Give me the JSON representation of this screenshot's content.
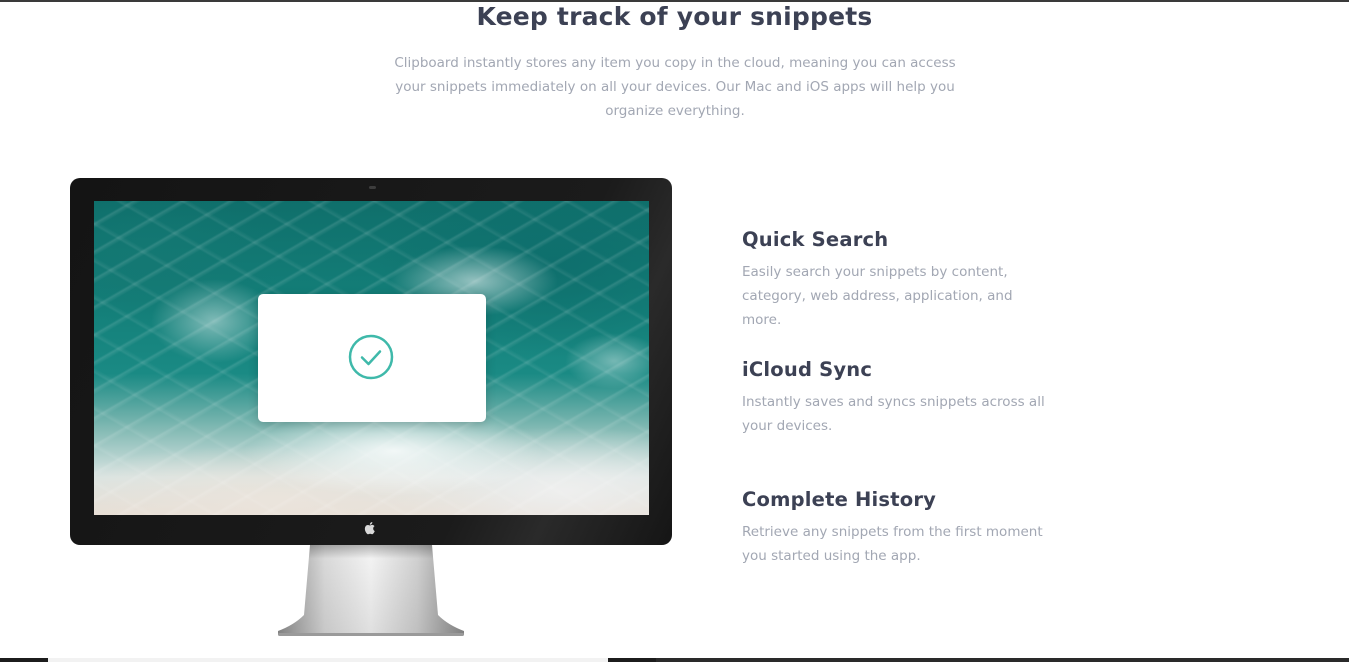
{
  "section": {
    "title": "Keep track of your snippets",
    "intro": "Clipboard instantly stores any item you copy in the cloud, meaning you can access your snippets immediately on all your devices. Our Mac and iOS apps will help you organize everything."
  },
  "monitor": {
    "screen_icon": "check-circle-icon",
    "logo_icon": "apple-logo-icon",
    "accent_color": "#3fb9aa"
  },
  "features": [
    {
      "title": "Quick Search",
      "description": "Easily search your snippets by content, category, web address, application, and more."
    },
    {
      "title": "iCloud Sync",
      "description": "Instantly saves and syncs snippets across all your devices."
    },
    {
      "title": "Complete History",
      "description": "Retrieve any snippets from the first moment you started using the app."
    }
  ],
  "colors": {
    "heading": "#3c4154",
    "body_text": "#a2a7b3",
    "background": "#ffffff"
  }
}
